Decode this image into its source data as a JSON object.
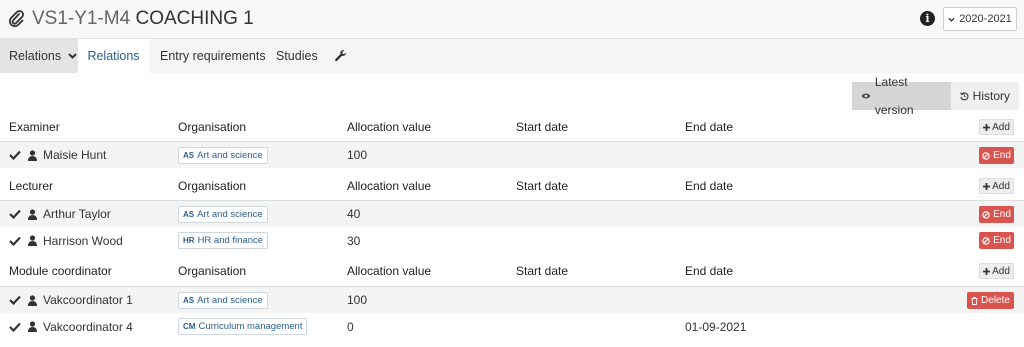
{
  "header": {
    "title_code": "VS1-Y1-M4",
    "title_name": "COACHING 1",
    "year": "2020-2021",
    "info_icon": "info-icon",
    "paperclip_icon": "paperclip-icon"
  },
  "tabs": {
    "dropdown_label": "Relations",
    "active_label": "Relations",
    "entry_label": "Entry requirements",
    "studies_label": "Studies",
    "settings_icon": "wrench-icon"
  },
  "version": {
    "latest_label": "Latest version",
    "history_label": "History"
  },
  "columns": {
    "organisation": "Organisation",
    "allocation": "Allocation value",
    "start": "Start date",
    "end": "End date"
  },
  "buttons": {
    "add": "Add",
    "end": "End",
    "delete": "Delete"
  },
  "sections": [
    {
      "role": "Examiner",
      "rows": [
        {
          "name": "Maisie Hunt",
          "org_abbr": "AS",
          "org_name": "Art and science",
          "allocation": "100",
          "start": "",
          "end": "",
          "action": "end"
        }
      ]
    },
    {
      "role": "Lecturer",
      "rows": [
        {
          "name": "Arthur Taylor",
          "org_abbr": "AS",
          "org_name": "Art and science",
          "allocation": "40",
          "start": "",
          "end": "",
          "action": "end"
        },
        {
          "name": "Harrison Wood",
          "org_abbr": "HR",
          "org_name": "HR and finance",
          "allocation": "30",
          "start": "",
          "end": "",
          "action": "end"
        }
      ]
    },
    {
      "role": "Module coordinator",
      "rows": [
        {
          "name": "Vakcoordinator 1",
          "org_abbr": "AS",
          "org_name": "Art and science",
          "allocation": "100",
          "start": "",
          "end": "",
          "action": "delete"
        },
        {
          "name": "Vakcoordinator 4",
          "org_abbr": "CM",
          "org_name": "Curriculum management",
          "allocation": "0",
          "start": "",
          "end": "01-09-2021",
          "action": ""
        }
      ]
    }
  ],
  "colors": {
    "accent_blue": "#2a5f8e",
    "danger_red": "#d9534f",
    "header_bg": "#f8f8f8"
  }
}
